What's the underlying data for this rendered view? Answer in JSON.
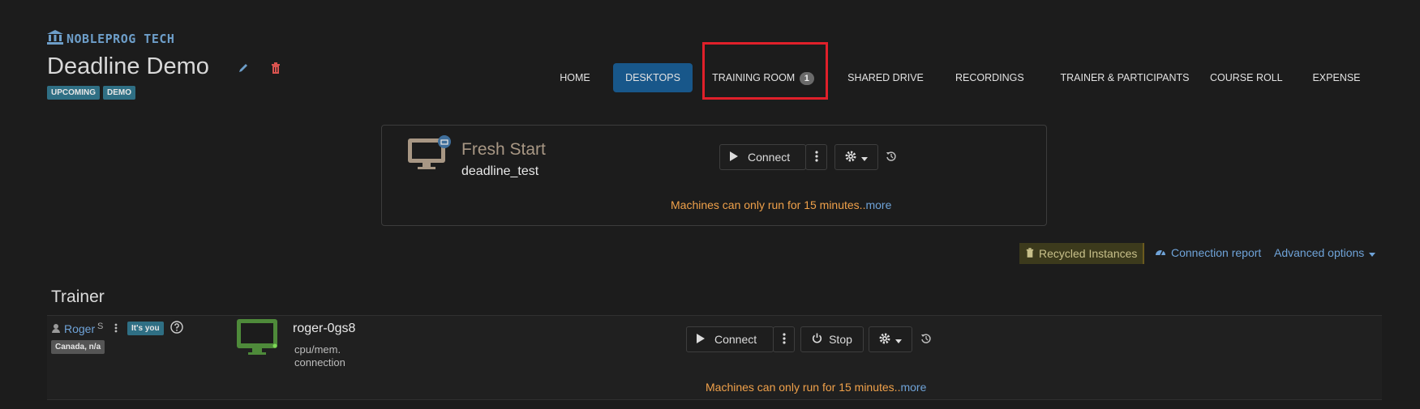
{
  "org": {
    "name": "NOBLEPROG TECH",
    "icon": "bank-icon"
  },
  "course": {
    "title": "Deadline Demo",
    "badges": [
      "UPCOMING",
      "DEMO"
    ]
  },
  "nav": {
    "items": [
      "HOME",
      "DESKTOPS",
      "TRAINING ROOM",
      "SHARED DRIVE",
      "RECORDINGS",
      "TRAINER & PARTICIPANTS",
      "COURSE ROLL",
      "EXPENSE"
    ],
    "active": "DESKTOPS",
    "training_room_count": "1"
  },
  "template": {
    "name": "Fresh Start",
    "id": "deadline_test",
    "connect_label": "Connect",
    "warning": "Machines can only run for 15 minutes..",
    "more_label": "more"
  },
  "options": {
    "recycled": "Recycled Instances",
    "connection_report": "Connection report",
    "advanced": "Advanced options"
  },
  "trainer": {
    "heading": "Trainer",
    "user_name": "Roger",
    "user_initial": "S",
    "its_you": "It's you",
    "location": "Canada, n/a",
    "machine_name": "roger-0gs8",
    "stat1": "cpu/mem.",
    "stat2": "connection",
    "connect_label": "Connect",
    "stop_label": "Stop",
    "warning": "Machines can only run for 15 minutes..",
    "more_label": "more"
  },
  "colors": {
    "accent": "#18578a",
    "warning": "#f0a14a",
    "link": "#6fa3d8",
    "highlight": "#e0202a"
  }
}
